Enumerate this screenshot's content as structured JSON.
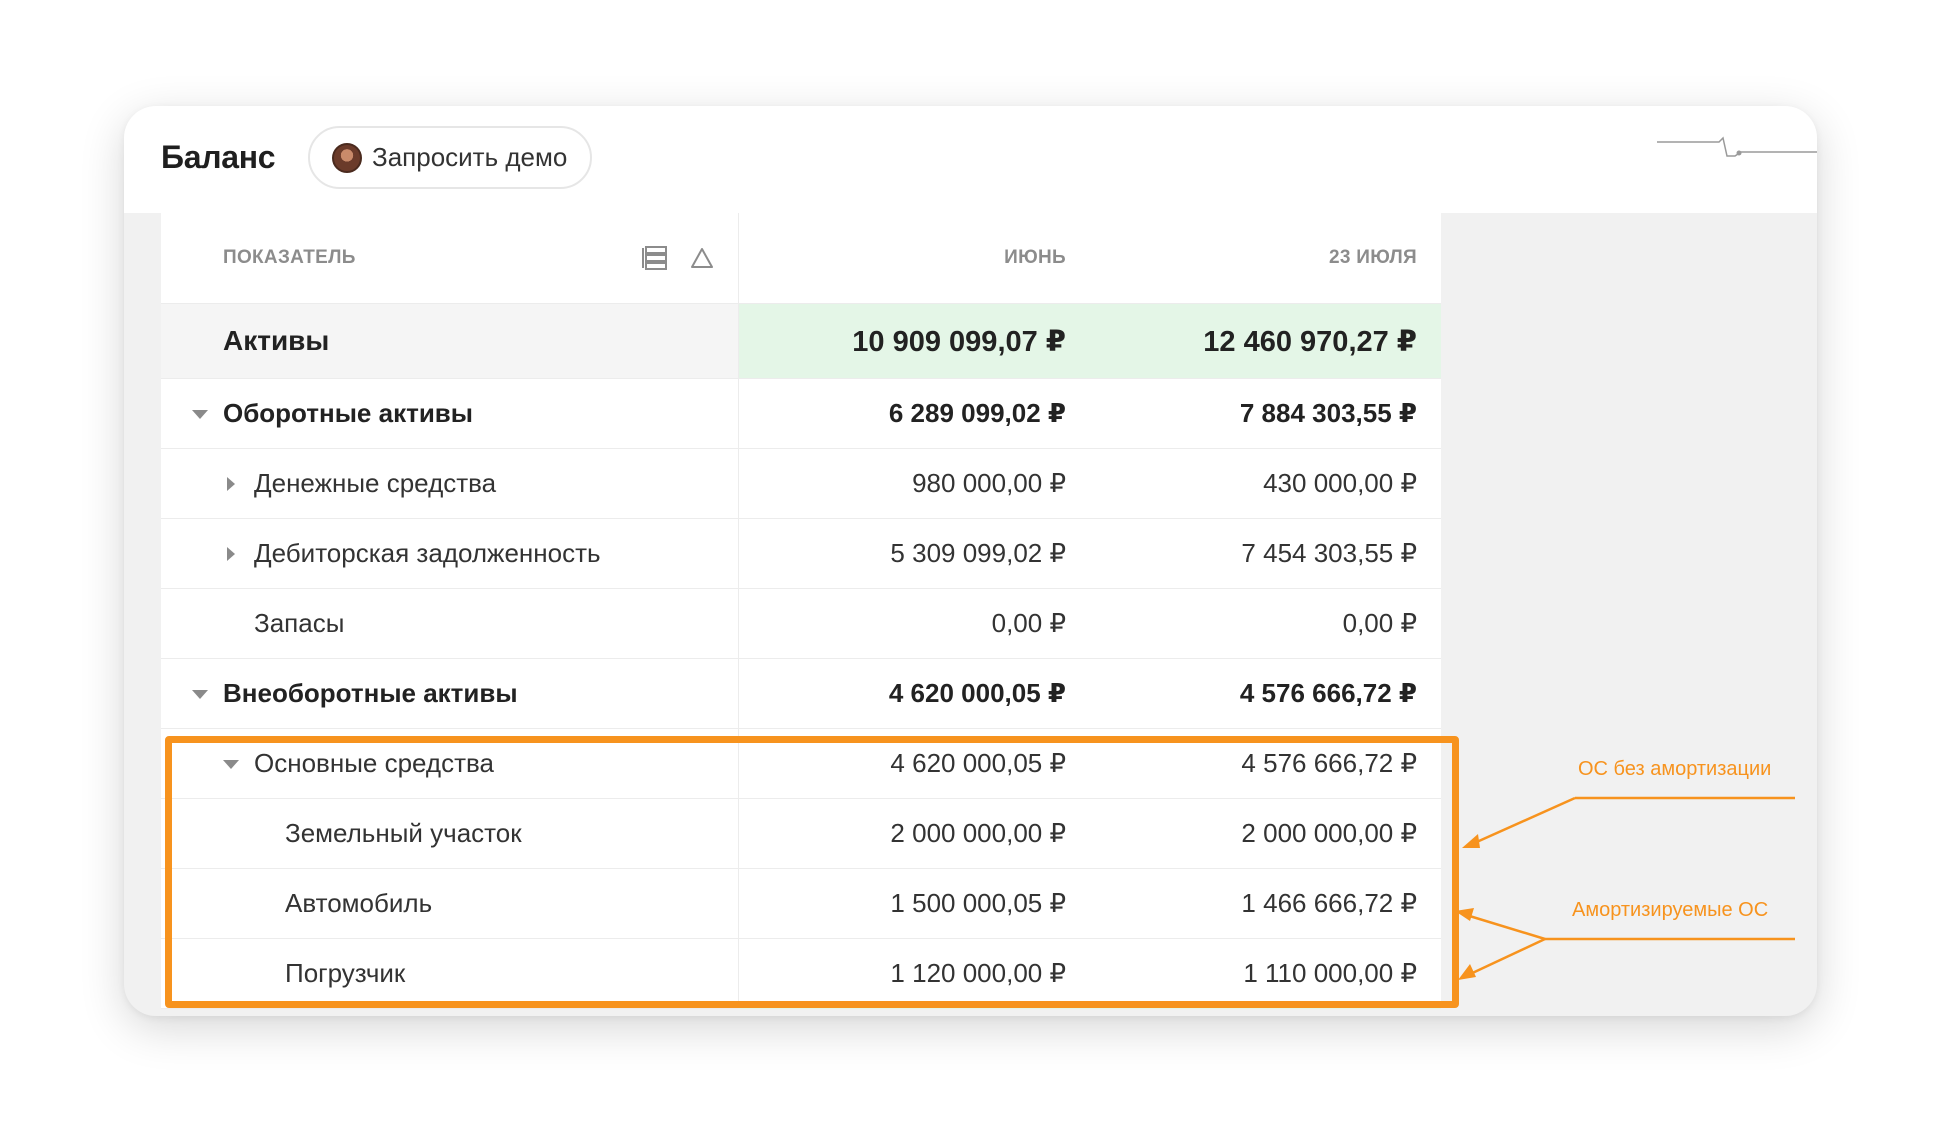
{
  "header": {
    "title": "Баланс",
    "demo_button": "Запросить демо"
  },
  "table": {
    "columns": {
      "indicator": "ПОКАЗАТЕЛЬ",
      "june": "ИЮНЬ",
      "july": "23 ИЮЛЯ"
    },
    "total": {
      "label": "Активы",
      "june": "10 909 099,07 ₽",
      "july": "12 460 970,27 ₽"
    },
    "rows": [
      {
        "label": "Оборотные активы",
        "june": "6 289 099,02 ₽",
        "july": "7 884 303,55 ₽"
      },
      {
        "label": "Денежные средства",
        "june": "980 000,00 ₽",
        "july": "430 000,00 ₽"
      },
      {
        "label": "Дебиторская задолженность",
        "june": "5 309 099,02 ₽",
        "july": "7 454 303,55 ₽"
      },
      {
        "label": "Запасы",
        "june": "0,00 ₽",
        "july": "0,00 ₽"
      },
      {
        "label": "Внеоборотные активы",
        "june": "4 620 000,05 ₽",
        "july": "4 576 666,72 ₽"
      },
      {
        "label": "Основные средства",
        "june": "4 620 000,05 ₽",
        "july": "4 576 666,72 ₽"
      },
      {
        "label": "Земельный участок",
        "june": "2 000 000,00 ₽",
        "july": "2 000 000,00 ₽"
      },
      {
        "label": "Автомобиль",
        "june": "1 500 000,05 ₽",
        "july": "1 466 666,72 ₽"
      },
      {
        "label": "Погрузчик",
        "june": "1 120 000,00 ₽",
        "july": "1 110 000,00 ₽"
      }
    ]
  },
  "annotations": {
    "no_amortization": "ОС без амортизации",
    "amortizable": "Амортизируемые ОС"
  },
  "colors": {
    "accent_orange": "#f7931e",
    "total_green": "#e4f6e7"
  }
}
